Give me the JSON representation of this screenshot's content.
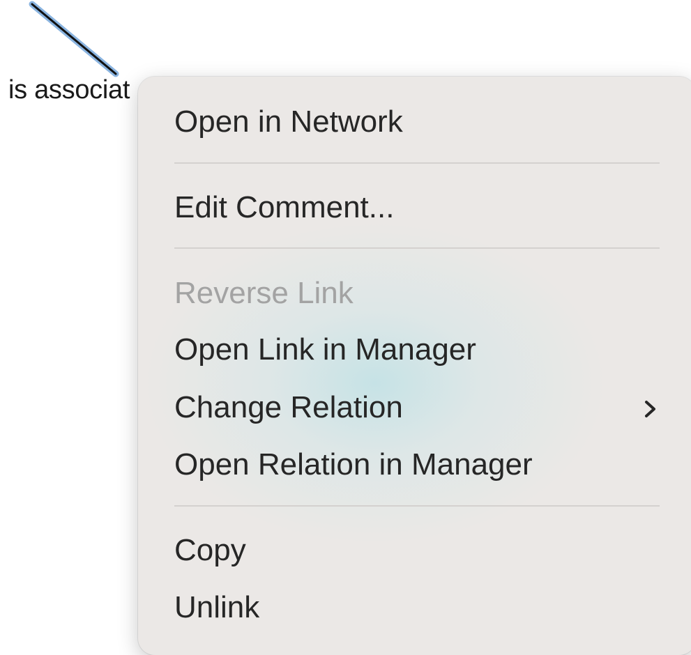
{
  "canvas": {
    "link_label": "is associat"
  },
  "context_menu": {
    "items": [
      {
        "label": "Open in Network",
        "enabled": true
      },
      {
        "label": "Edit Comment...",
        "enabled": true
      },
      {
        "label": "Reverse Link",
        "enabled": false
      },
      {
        "label": "Open Link in Manager",
        "enabled": true
      },
      {
        "label": "Change Relation",
        "enabled": true,
        "submenu": true
      },
      {
        "label": "Open Relation in Manager",
        "enabled": true
      },
      {
        "label": "Copy",
        "enabled": true
      },
      {
        "label": "Unlink",
        "enabled": true
      }
    ],
    "submenu_icon": "chevron-right-icon"
  },
  "colors": {
    "menu_background": "#ebe8e6",
    "menu_text": "#262626",
    "disabled_text": "#a3a3a3",
    "separator": "#d4d1cf",
    "selection_highlight": "#8ab4e0",
    "link_line": "#111111"
  }
}
